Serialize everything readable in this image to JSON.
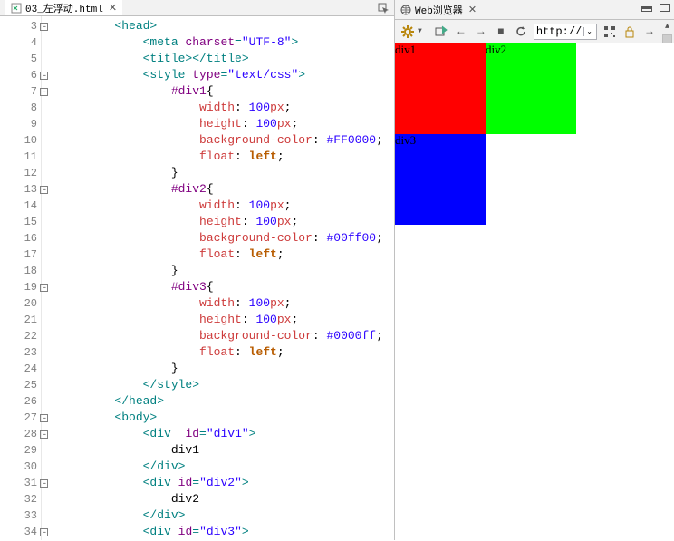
{
  "editor": {
    "tab_file": "03_左浮动.html",
    "lines": [
      {
        "n": "3",
        "fold": "minus",
        "ind": 2,
        "tok": [
          [
            "tag",
            "<head>"
          ]
        ]
      },
      {
        "n": "4",
        "ind": 3,
        "tok": [
          [
            "tag",
            "<meta "
          ],
          [
            "attr",
            "charset"
          ],
          [
            "tag",
            "="
          ],
          [
            "str",
            "\"UTF-8\""
          ],
          [
            "tag",
            ">"
          ]
        ]
      },
      {
        "n": "5",
        "ind": 3,
        "tok": [
          [
            "tag",
            "<title></title>"
          ]
        ]
      },
      {
        "n": "6",
        "fold": "minus",
        "ind": 3,
        "tok": [
          [
            "tag",
            "<style "
          ],
          [
            "attr",
            "type"
          ],
          [
            "tag",
            "="
          ],
          [
            "str",
            "\"text/css\""
          ],
          [
            "tag",
            ">"
          ]
        ]
      },
      {
        "n": "7",
        "fold": "minus",
        "ind": 4,
        "tok": [
          [
            "sel",
            "#div1"
          ],
          [
            "pct",
            "{"
          ]
        ]
      },
      {
        "n": "8",
        "ind": 5,
        "tok": [
          [
            "prop",
            "width"
          ],
          [
            "pct",
            ": "
          ],
          [
            "num",
            "100"
          ],
          [
            "funcv",
            "px"
          ],
          [
            "pct",
            ";"
          ]
        ]
      },
      {
        "n": "9",
        "ind": 5,
        "tok": [
          [
            "prop",
            "height"
          ],
          [
            "pct",
            ": "
          ],
          [
            "num",
            "100"
          ],
          [
            "funcv",
            "px"
          ],
          [
            "pct",
            ";"
          ]
        ]
      },
      {
        "n": "10",
        "ind": 5,
        "tok": [
          [
            "prop",
            "background-color"
          ],
          [
            "pct",
            ": "
          ],
          [
            "hex",
            "#FF0000"
          ],
          [
            "pct",
            ";"
          ]
        ]
      },
      {
        "n": "11",
        "ind": 5,
        "tok": [
          [
            "prop",
            "float"
          ],
          [
            "pct",
            ": "
          ],
          [
            "fb",
            "left"
          ],
          [
            "pct",
            ";"
          ]
        ]
      },
      {
        "n": "12",
        "ind": 4,
        "tok": [
          [
            "pct",
            "}"
          ]
        ]
      },
      {
        "n": "13",
        "fold": "minus",
        "ind": 4,
        "tok": [
          [
            "sel",
            "#div2"
          ],
          [
            "pct",
            "{"
          ]
        ]
      },
      {
        "n": "14",
        "ind": 5,
        "tok": [
          [
            "prop",
            "width"
          ],
          [
            "pct",
            ": "
          ],
          [
            "num",
            "100"
          ],
          [
            "funcv",
            "px"
          ],
          [
            "pct",
            ";"
          ]
        ]
      },
      {
        "n": "15",
        "ind": 5,
        "tok": [
          [
            "prop",
            "height"
          ],
          [
            "pct",
            ": "
          ],
          [
            "num",
            "100"
          ],
          [
            "funcv",
            "px"
          ],
          [
            "pct",
            ";"
          ]
        ]
      },
      {
        "n": "16",
        "ind": 5,
        "tok": [
          [
            "prop",
            "background-color"
          ],
          [
            "pct",
            ": "
          ],
          [
            "hex",
            "#00ff00"
          ],
          [
            "pct",
            ";"
          ]
        ]
      },
      {
        "n": "17",
        "ind": 5,
        "tok": [
          [
            "prop",
            "float"
          ],
          [
            "pct",
            ": "
          ],
          [
            "fb",
            "left"
          ],
          [
            "pct",
            ";"
          ]
        ]
      },
      {
        "n": "18",
        "ind": 4,
        "tok": [
          [
            "pct",
            "}"
          ]
        ]
      },
      {
        "n": "19",
        "fold": "minus",
        "ind": 4,
        "tok": [
          [
            "sel",
            "#div3"
          ],
          [
            "pct",
            "{"
          ]
        ]
      },
      {
        "n": "20",
        "ind": 5,
        "tok": [
          [
            "prop",
            "width"
          ],
          [
            "pct",
            ": "
          ],
          [
            "num",
            "100"
          ],
          [
            "funcv",
            "px"
          ],
          [
            "pct",
            ";"
          ]
        ]
      },
      {
        "n": "21",
        "ind": 5,
        "tok": [
          [
            "prop",
            "height"
          ],
          [
            "pct",
            ": "
          ],
          [
            "num",
            "100"
          ],
          [
            "funcv",
            "px"
          ],
          [
            "pct",
            ";"
          ]
        ]
      },
      {
        "n": "22",
        "ind": 5,
        "tok": [
          [
            "prop",
            "background-color"
          ],
          [
            "pct",
            ": "
          ],
          [
            "hex",
            "#0000ff"
          ],
          [
            "pct",
            ";"
          ]
        ]
      },
      {
        "n": "23",
        "ind": 5,
        "tok": [
          [
            "prop",
            "float"
          ],
          [
            "pct",
            ": "
          ],
          [
            "fb",
            "left"
          ],
          [
            "pct",
            ";"
          ]
        ]
      },
      {
        "n": "24",
        "ind": 4,
        "tok": [
          [
            "pct",
            "}"
          ]
        ]
      },
      {
        "n": "25",
        "ind": 3,
        "tok": [
          [
            "tag",
            "</style>"
          ]
        ]
      },
      {
        "n": "26",
        "ind": 2,
        "tok": [
          [
            "tag",
            "</head>"
          ]
        ]
      },
      {
        "n": "27",
        "fold": "minus",
        "ind": 2,
        "tok": [
          [
            "tag",
            "<body>"
          ]
        ]
      },
      {
        "n": "28",
        "fold": "minus",
        "ind": 3,
        "tok": [
          [
            "tag",
            "<div  "
          ],
          [
            "attr",
            "id"
          ],
          [
            "tag",
            "="
          ],
          [
            "str",
            "\"div1\""
          ],
          [
            "tag",
            ">"
          ]
        ]
      },
      {
        "n": "29",
        "ind": 4,
        "tok": [
          [
            "pct",
            "div1"
          ]
        ]
      },
      {
        "n": "30",
        "ind": 3,
        "tok": [
          [
            "tag",
            "</div>"
          ]
        ]
      },
      {
        "n": "31",
        "fold": "minus",
        "ind": 3,
        "tok": [
          [
            "tag",
            "<div "
          ],
          [
            "attr",
            "id"
          ],
          [
            "tag",
            "="
          ],
          [
            "str",
            "\"div2\""
          ],
          [
            "tag",
            ">"
          ]
        ]
      },
      {
        "n": "32",
        "ind": 4,
        "tok": [
          [
            "pct",
            "div2"
          ]
        ]
      },
      {
        "n": "33",
        "ind": 3,
        "tok": [
          [
            "tag",
            "</div>"
          ]
        ]
      },
      {
        "n": "34",
        "fold": "minus",
        "ind": 3,
        "tok": [
          [
            "tag",
            "<div "
          ],
          [
            "attr",
            "id"
          ],
          [
            "tag",
            "="
          ],
          [
            "str",
            "\"div3\""
          ],
          [
            "tag",
            ">"
          ]
        ]
      }
    ]
  },
  "browser": {
    "tab_title": "Web浏览器",
    "url_scheme": "http://",
    "divs": [
      {
        "label": "div1"
      },
      {
        "label": "div2"
      },
      {
        "label": "div3"
      }
    ]
  }
}
